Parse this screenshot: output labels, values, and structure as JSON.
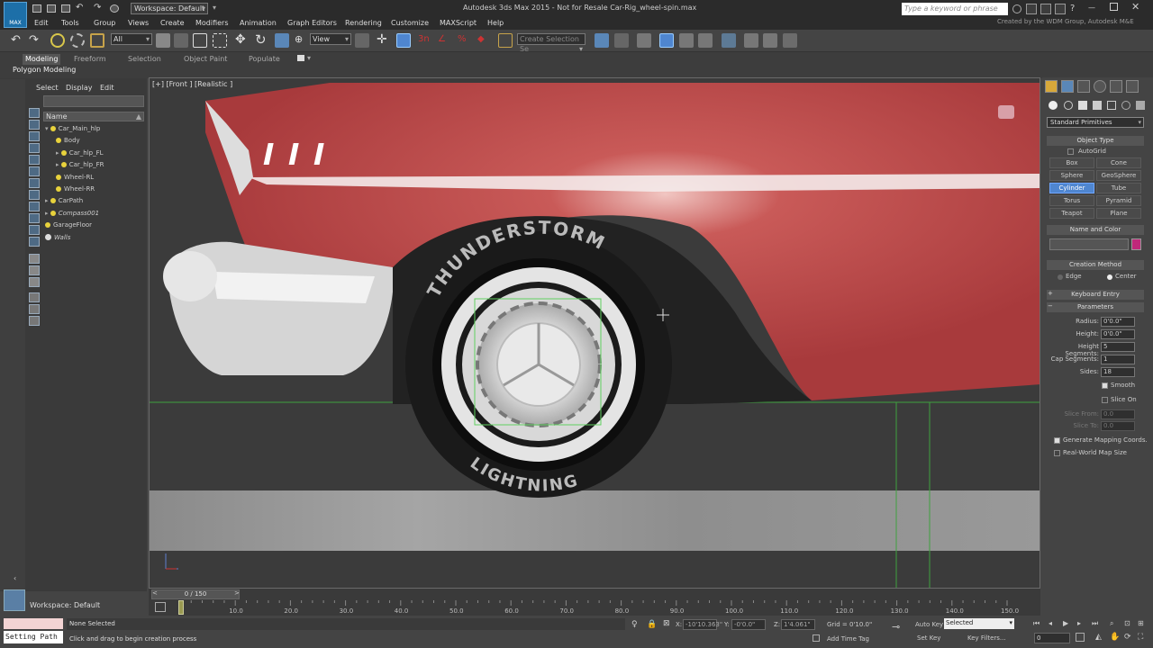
{
  "app": {
    "title": "Autodesk 3ds Max  2015    - Not for Resale    Car-Rig_wheel-spin.max",
    "logo_label": "MAX",
    "workspace": "Workspace: Default",
    "search_placeholder": "Type a keyword or phrase",
    "credit": "Created by the WDM Group, Autodesk M&E"
  },
  "menu": [
    "Edit",
    "Tools",
    "Group",
    "Views",
    "Create",
    "Modifiers",
    "Animation",
    "Graph Editors",
    "Rendering",
    "Customize",
    "MAXScript",
    "Help"
  ],
  "toolbar": {
    "filter": "All",
    "ref_coord": "View",
    "selection_set": "Create Selection Se"
  },
  "ribbon": {
    "tabs": [
      "Modeling",
      "Freeform",
      "Selection",
      "Object Paint",
      "Populate"
    ],
    "active_tab": "Modeling",
    "panel": "Polygon Modeling"
  },
  "scene_explorer": {
    "menus": [
      "Select",
      "Display",
      "Edit"
    ],
    "column": "Name",
    "items": [
      {
        "name": "Car_Main_hlp",
        "indent": 0,
        "italic": false,
        "icon": "bulb"
      },
      {
        "name": "Body",
        "indent": 1,
        "italic": false,
        "icon": "bulb"
      },
      {
        "name": "Car_hlp_FL",
        "indent": 1,
        "italic": false,
        "icon": "bulb"
      },
      {
        "name": "Car_hlp_FR",
        "indent": 1,
        "italic": false,
        "icon": "bulb"
      },
      {
        "name": "Wheel-RL",
        "indent": 1,
        "italic": false,
        "icon": "bulb"
      },
      {
        "name": "Wheel-RR",
        "indent": 1,
        "italic": false,
        "icon": "bulb"
      },
      {
        "name": "CarPath",
        "indent": 0,
        "italic": false,
        "icon": "bulb"
      },
      {
        "name": "Compass001",
        "indent": 0,
        "italic": true,
        "icon": "bulb"
      },
      {
        "name": "GarageFloor",
        "indent": 0,
        "italic": false,
        "icon": "bulb"
      },
      {
        "name": "Walls",
        "indent": 0,
        "italic": true,
        "icon": "eye"
      }
    ],
    "workspace_label": "Workspace: Default"
  },
  "viewport": {
    "label": "[+] [Front ] [Realistic ]",
    "tire_top_text": "THUNDERSTORM",
    "tire_bottom_text": "LIGHTNING"
  },
  "command_panel": {
    "category": "Standard Primitives",
    "object_type": {
      "title": "Object Type",
      "autogrid": "AutoGrid",
      "buttons": [
        "Box",
        "Cone",
        "Sphere",
        "GeoSphere",
        "Cylinder",
        "Tube",
        "Torus",
        "Pyramid",
        "Teapot",
        "Plane"
      ],
      "active": "Cylinder"
    },
    "name_and_color": {
      "title": "Name and Color",
      "color": "#c0287a"
    },
    "creation_method": {
      "title": "Creation Method",
      "options": [
        "Edge",
        "Center"
      ],
      "selected": "Center"
    },
    "keyboard_entry": "Keyboard Entry",
    "parameters": {
      "title": "Parameters",
      "fields": [
        {
          "label": "Radius:",
          "value": "0'0.0\"",
          "enabled": true
        },
        {
          "label": "Height:",
          "value": "0'0.0\"",
          "enabled": true
        },
        {
          "label": "Height Segments:",
          "value": "5",
          "enabled": true
        },
        {
          "label": "Cap Segments:",
          "value": "1",
          "enabled": true
        },
        {
          "label": "Sides:",
          "value": "18",
          "enabled": true
        }
      ],
      "smooth": {
        "label": "Smooth",
        "checked": true
      },
      "slice_on": {
        "label": "Slice On",
        "checked": false
      },
      "slice_fields": [
        {
          "label": "Slice From:",
          "value": "0.0"
        },
        {
          "label": "Slice To:",
          "value": "0.0"
        }
      ],
      "gen_mapping": {
        "label": "Generate Mapping Coords.",
        "checked": true
      },
      "real_world": {
        "label": "Real-World Map Size",
        "checked": false
      }
    }
  },
  "timeline": {
    "slider": "0 / 150",
    "current": 0,
    "max": 150,
    "ticks": [
      "0",
      "10.0",
      "20.0",
      "30.0",
      "40.0",
      "50.0",
      "60.0",
      "70.0",
      "80.0",
      "90.0",
      "100.0",
      "110.0",
      "120.0",
      "130.0",
      "140.0",
      "150.0"
    ]
  },
  "status": {
    "maxscript": "Setting Path",
    "selection": "None Selected",
    "prompt": "Click and drag to begin creation process",
    "x": "-10'10.363\"",
    "y": "-0'0.0\"",
    "z": "1'4.061\"",
    "grid": "Grid = 0'10.0\"",
    "auto_key": "Auto Key",
    "key_mode": "Selected",
    "set_key": "Set Key",
    "key_filters": "Key Filters...",
    "add_time_tag": "Add Time Tag",
    "frame": "0"
  }
}
